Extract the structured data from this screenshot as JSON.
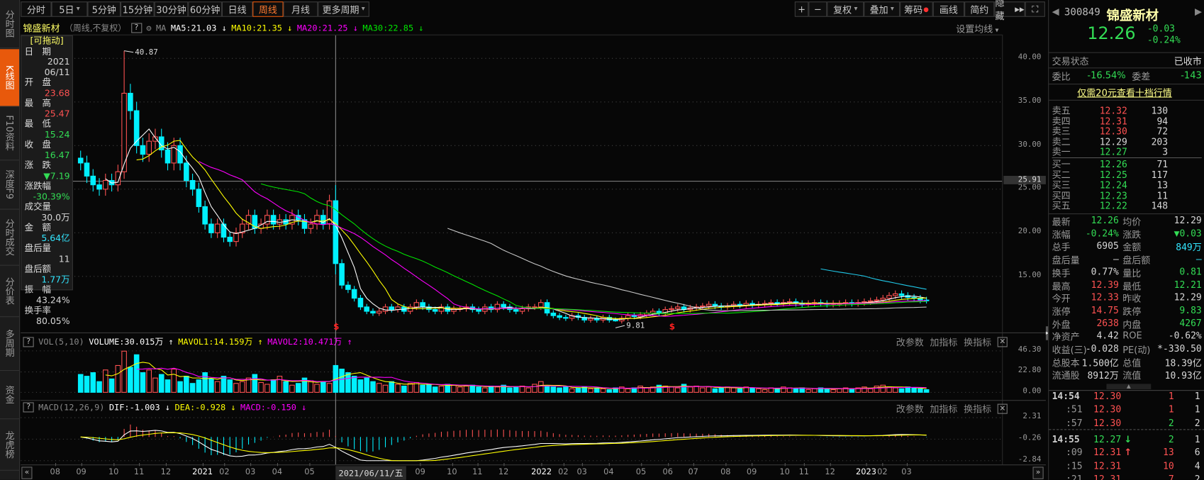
{
  "sidebar": {
    "tabs": [
      "分时图",
      "K线图",
      "F10资料",
      "深度F9",
      "分时成交",
      "分价表",
      "多周期",
      "资金",
      "龙虎榜"
    ],
    "active": 1
  },
  "toolbar": {
    "periods": [
      "分时",
      "5日",
      "5分钟",
      "15分钟",
      "30分钟",
      "60分钟",
      "日线",
      "周线",
      "月线",
      "更多周期"
    ],
    "active_period": "周线",
    "right_buttons": [
      "+",
      "−",
      "复权",
      "叠加",
      "筹码",
      "画线",
      "简约",
      "隐藏"
    ]
  },
  "infoline": {
    "name": "锦盛新材",
    "mode": "（周线,不复权）",
    "help": "?",
    "ma_label": "MA",
    "ma5": "MA5:21.03",
    "ma10": "MA10:21.35",
    "ma20": "MA20:21.25",
    "ma30": "MA30:22.85",
    "arrow": "↓",
    "set_ma": "设置均线"
  },
  "overlay": {
    "drag": "[可拖动]",
    "items": [
      {
        "label": "日　期",
        "value": "2021",
        "value2": "06/11",
        "tone": "flat"
      },
      {
        "label": "开　盘",
        "value": "23.68",
        "tone": "up"
      },
      {
        "label": "最　高",
        "value": "25.47",
        "tone": "up"
      },
      {
        "label": "最　低",
        "value": "15.24",
        "tone": "down"
      },
      {
        "label": "收　盘",
        "value": "16.47",
        "tone": "down"
      },
      {
        "label": "涨　跌",
        "value": "▼7.19",
        "tone": "down"
      },
      {
        "label": "涨跌幅",
        "value": "-30.39%",
        "tone": "down"
      },
      {
        "label": "成交量",
        "value": "30.0万",
        "tone": "flat"
      },
      {
        "label": "金　额",
        "value": "5.64亿",
        "tone": "cyan"
      },
      {
        "label": "盘后量",
        "value": "11",
        "tone": "flat"
      },
      {
        "label": "盘后额",
        "value": "1.77万",
        "tone": "cyan"
      },
      {
        "label": "振　幅",
        "value": "43.24%",
        "tone": "flat"
      },
      {
        "label": "换手率",
        "value": "80.05%",
        "tone": "flat"
      }
    ]
  },
  "price_axis": {
    "labels": [
      "40.00",
      "35.00",
      "30.00",
      "25.00",
      "20.00",
      "15.00"
    ],
    "values": [
      40,
      35,
      30,
      25,
      20,
      15
    ],
    "crosshair": "25.91"
  },
  "volume_panel": {
    "help": "?",
    "title": "VOL(5,10)",
    "volume": "VOLUME:30.015万",
    "mavol1": "MAVOL1:14.159万",
    "mavol2": "MAVOL2:10.471万",
    "arrow": "↑",
    "axis": [
      "46.30",
      "22.80",
      "0.00"
    ],
    "axis_values": [
      46.3,
      22.8,
      0
    ]
  },
  "macd_panel": {
    "help": "?",
    "title": "MACD(12,26,9)",
    "dif": "DIF:-1.003",
    "dea": "DEA:-0.928",
    "macd": "MACD:-0.150",
    "arrow": "↓",
    "axis": [
      "2.31",
      "-0.26",
      "-2.84"
    ],
    "axis_values": [
      2.31,
      -0.26,
      -2.84
    ]
  },
  "panel_links": [
    "改参数",
    "加指标",
    "换指标"
  ],
  "date_tag": "2021/06/11/五",
  "colors": {
    "up": "#ff5252",
    "down": "#00f0ff",
    "ma5": "#ffffff",
    "ma10": "#ffff00",
    "ma20": "#ff00ff",
    "ma30": "#00e600",
    "ma60": "#c8c8c8",
    "ma120": "#20c8e8",
    "accent": "#e8590c"
  },
  "chart_data": {
    "type": "candlestick",
    "period": "weekly",
    "closes": [
      28,
      26.5,
      25.5,
      25,
      26,
      25.5,
      27,
      36,
      34,
      30,
      29,
      30.5,
      31,
      29.5,
      28,
      30,
      28,
      26,
      25,
      23,
      21,
      20,
      21,
      19.5,
      19,
      20,
      21,
      22,
      20.5,
      21,
      22,
      21,
      21.5,
      21,
      22,
      21.5,
      20.5,
      21,
      22,
      21,
      23.66,
      16.47,
      14,
      13.5,
      12.5,
      11.5,
      11,
      10.8,
      11,
      11.5,
      11.2,
      11.5,
      11,
      11.5,
      12,
      11.5,
      11.2,
      11,
      11.5,
      11,
      11.3,
      11.3,
      11.5,
      11.2,
      11,
      11.5,
      11.2,
      11.8,
      11.5,
      11.2,
      11,
      11.3,
      11.5,
      11.5,
      12,
      10.8,
      10.5,
      10.3,
      10.2,
      10.5,
      10.3,
      10,
      10.2,
      10,
      10.3,
      10,
      9.9,
      10.2,
      10.5,
      10.4,
      10.6,
      10.8,
      11,
      10.8,
      11.2,
      11.3,
      11.5,
      11.2,
      11.4,
      11.5,
      11.6,
      11.8,
      11.6,
      11.5,
      11.6,
      11.8,
      11.7,
      11.9,
      11.7,
      11.8,
      11.9,
      12,
      11.9,
      12,
      12.1,
      11.9,
      11.8,
      11.9,
      12,
      11.9,
      11.8,
      11.9,
      11.9,
      12,
      11.9,
      12,
      12.1,
      12.2,
      12.3,
      12.5,
      12.8,
      13.0,
      12.8,
      12.6,
      12.5,
      12.29,
      12.26
    ],
    "volumes": [
      20,
      18,
      22,
      12,
      25,
      15,
      30,
      46,
      28,
      42,
      22,
      25,
      16,
      20,
      14,
      26,
      12,
      18,
      10,
      14,
      22,
      15,
      12,
      18,
      14,
      10,
      12,
      16,
      20,
      11,
      9,
      14,
      18,
      12,
      8,
      10,
      16,
      13,
      9,
      12,
      10,
      30.0,
      26,
      22,
      18,
      14,
      16,
      12,
      10,
      8,
      12,
      9,
      7,
      10,
      11,
      8,
      9,
      6,
      7,
      9,
      8,
      6,
      7,
      8,
      6,
      5,
      7,
      6,
      8,
      5,
      6,
      7,
      5,
      9,
      12,
      7,
      6,
      5,
      6,
      4,
      5,
      6,
      4,
      5,
      4,
      3,
      5,
      6,
      4,
      5,
      7,
      5,
      6,
      8,
      7,
      6,
      5,
      9,
      6,
      7,
      5,
      6,
      4,
      5,
      6,
      5,
      4,
      6,
      5,
      4,
      3,
      5,
      4,
      6,
      5,
      4,
      5,
      3,
      4,
      5,
      4,
      3,
      4,
      5,
      4,
      5,
      6,
      4,
      7,
      8,
      6,
      5,
      4,
      6,
      5,
      4,
      3
    ],
    "selected": {
      "index": 41,
      "open": 23.68,
      "high": 25.47,
      "low": 15.24,
      "close": 16.47
    },
    "max_marker": {
      "index": 7,
      "value": 40.87,
      "label": "40.87"
    },
    "min_marker": {
      "index": 86,
      "value": 9.81,
      "label": "9.81"
    },
    "signals": [
      {
        "index": 41,
        "label": "$"
      },
      {
        "index": 95,
        "label": "$"
      }
    ],
    "ma_periods": [
      5,
      10,
      20,
      30,
      60,
      120
    ],
    "price_range": [
      9,
      41
    ],
    "x_labels": [
      {
        "label": "08",
        "week": -4.1
      },
      {
        "label": "09",
        "week": 0.1
      },
      {
        "label": "10",
        "week": 5.3
      },
      {
        "label": "11",
        "week": 9.4
      },
      {
        "label": "12",
        "week": 13.7
      },
      {
        "label": "2021",
        "week": 19.6,
        "year": true
      },
      {
        "label": "02",
        "week": 23.1
      },
      {
        "label": "03",
        "week": 27.3
      },
      {
        "label": "04",
        "week": 31.6
      },
      {
        "label": "05",
        "week": 36.8
      },
      {
        "label": "09",
        "week": 54.6
      },
      {
        "label": "10",
        "week": 59.7
      },
      {
        "label": "11",
        "week": 63.8
      },
      {
        "label": "12",
        "week": 68
      },
      {
        "label": "2022",
        "week": 74.1,
        "year": true
      },
      {
        "label": "02",
        "week": 77.6
      },
      {
        "label": "03",
        "week": 80.6
      },
      {
        "label": "04",
        "week": 84.9
      },
      {
        "label": "05",
        "week": 90.1
      },
      {
        "label": "06",
        "week": 94.4
      },
      {
        "label": "07",
        "week": 98.5
      },
      {
        "label": "08",
        "week": 103.7
      },
      {
        "label": "09",
        "week": 107.9
      },
      {
        "label": "10",
        "week": 113.2
      },
      {
        "label": "11",
        "week": 116.3
      },
      {
        "label": "12",
        "week": 120.5
      },
      {
        "label": "2023",
        "week": 126.3,
        "year": true
      },
      {
        "label": "02",
        "week": 128.9
      },
      {
        "label": "03",
        "week": 132.8
      }
    ]
  },
  "quote": {
    "code": "300849",
    "name": "锦盛新材",
    "price": "12.26",
    "change": "-0.03",
    "change_pct": "-0.24%",
    "status_label": "交易状态",
    "status": "已收市",
    "wb_label": "委比",
    "wb": "-16.54%",
    "wc_label": "委差",
    "wc": "-143",
    "promo": "仅需20元查看十档行情",
    "asks": [
      {
        "label": "卖五",
        "price": "12.32",
        "vol": "130",
        "tone": "up"
      },
      {
        "label": "卖四",
        "price": "12.31",
        "vol": "94",
        "tone": "up"
      },
      {
        "label": "卖三",
        "price": "12.30",
        "vol": "72",
        "tone": "up"
      },
      {
        "label": "卖二",
        "price": "12.29",
        "vol": "203",
        "tone": "flat"
      },
      {
        "label": "卖一",
        "price": "12.27",
        "vol": "3",
        "tone": "down"
      }
    ],
    "bids": [
      {
        "label": "买一",
        "price": "12.26",
        "vol": "71",
        "tone": "down"
      },
      {
        "label": "买二",
        "price": "12.25",
        "vol": "117",
        "tone": "down"
      },
      {
        "label": "买三",
        "price": "12.24",
        "vol": "13",
        "tone": "down"
      },
      {
        "label": "买四",
        "price": "12.23",
        "vol": "11",
        "tone": "down"
      },
      {
        "label": "买五",
        "price": "12.22",
        "vol": "148",
        "tone": "down"
      }
    ],
    "stats": [
      {
        "l1": "最新",
        "v1": "12.26",
        "t1": "down",
        "l2": "均价",
        "v2": "12.29",
        "t2": "flat"
      },
      {
        "l1": "涨幅",
        "v1": "-0.24%",
        "t1": "down",
        "l2": "涨跌",
        "v2": "▼0.03",
        "t2": "down"
      },
      {
        "l1": "总手",
        "v1": "6905",
        "t1": "flat",
        "l2": "金额",
        "v2": "849万",
        "t2": "cyan"
      },
      {
        "l1": "盘后量",
        "v1": "—",
        "t1": "flat",
        "l2": "盘后额",
        "v2": "—",
        "t2": "cyan"
      },
      {
        "l1": "换手",
        "v1": "0.77%",
        "t1": "flat",
        "l2": "量比",
        "v2": "0.81",
        "t2": "down"
      },
      {
        "l1": "最高",
        "v1": "12.39",
        "t1": "up",
        "l2": "最低",
        "v2": "12.21",
        "t2": "down"
      },
      {
        "l1": "今开",
        "v1": "12.33",
        "t1": "up",
        "l2": "昨收",
        "v2": "12.29",
        "t2": "flat"
      },
      {
        "l1": "涨停",
        "v1": "14.75",
        "t1": "up",
        "l2": "跌停",
        "v2": "9.83",
        "t2": "down"
      },
      {
        "l1": "外盘",
        "v1": "2638",
        "t1": "up",
        "l2": "内盘",
        "v2": "4267",
        "t2": "down"
      },
      {
        "l1": "净资产",
        "v1": "4.42",
        "t1": "flat",
        "l2": "ROE",
        "v2": "-0.62%",
        "t2": "flat"
      },
      {
        "l1": "收益(三)",
        "v1": "-0.028",
        "t1": "flat",
        "l2": "PE(动)",
        "v2": "*-330.50",
        "t2": "flat"
      },
      {
        "l1": "总股本",
        "v1": "1.500亿",
        "t1": "flat",
        "l2": "总值",
        "v2": "18.39亿",
        "t2": "flat"
      },
      {
        "l1": "流通股",
        "v1": "8912万",
        "t1": "flat",
        "l2": "流值",
        "v2": "10.93亿",
        "t2": "flat"
      }
    ],
    "ticks": [
      {
        "time": "14:54",
        "price": "12.30",
        "tone": "up",
        "arrow": "",
        "vol": "1",
        "vtone": "up",
        "n": "1"
      },
      {
        "time": ":51",
        "price": "12.30",
        "tone": "up",
        "arrow": "",
        "vol": "1",
        "vtone": "up",
        "n": "1"
      },
      {
        "time": ":57",
        "price": "12.30",
        "tone": "up",
        "arrow": "",
        "vol": "2",
        "vtone": "down",
        "n": "2"
      },
      {
        "time": "14:55",
        "price": "12.27",
        "tone": "down",
        "arrow": "↓",
        "vol": "2",
        "vtone": "down",
        "n": "1"
      },
      {
        "time": ":09",
        "price": "12.31",
        "tone": "up",
        "arrow": "↑",
        "vol": "13",
        "vtone": "up",
        "n": "6"
      },
      {
        "time": ":15",
        "price": "12.31",
        "tone": "up",
        "arrow": "",
        "vol": "10",
        "vtone": "up",
        "n": "4"
      },
      {
        "time": ":21",
        "price": "12.31",
        "tone": "up",
        "arrow": "",
        "vol": "7",
        "vtone": "up",
        "n": "2"
      }
    ]
  }
}
